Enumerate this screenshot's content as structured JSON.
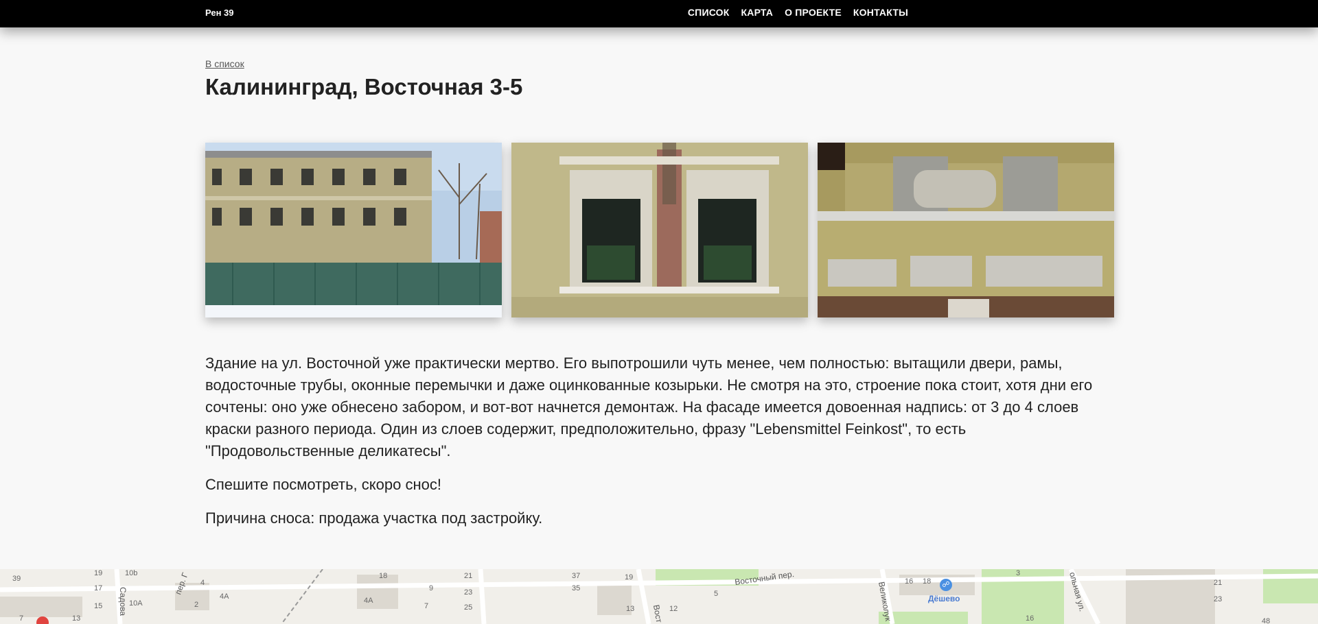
{
  "navbar": {
    "brand": "Рен 39",
    "links": [
      "СПИСОК",
      "КАРТА",
      "О ПРОЕКТЕ",
      "КОНТАКТЫ"
    ]
  },
  "back_link": "В список",
  "title": "Калининград, Восточная 3-5",
  "description": [
    "Здание на ул. Восточной уже практически мертво. Его выпотрошили чуть менее, чем полностью: вытащили двери, рамы, водосточные трубы, оконные перемычки и даже оцинкованные козырьки. Не смотря на это, строение пока стоит, хотя дни его сочтены: оно уже обнесено забором, и вот-вот начнется демонтаж. На фасаде имеется довоенная надпись: от 3 до 4 слоев краски разного периода. Один из слоев содержит, предположительно, фразу \"Lebensmittel Feinkost\", то есть \"Продовольственные деликатесы\".",
    "Спешите посмотреть, скоро снос!",
    "Причина сноса: продажа участка под застройку."
  ],
  "map": {
    "street_labels": [
      "Восточный пер.",
      "пер. Г",
      "Садова",
      "Великолук",
      "Вост",
      "ольная ул."
    ],
    "poi": "Дёшево",
    "house_numbers": [
      "39",
      "19",
      "10b",
      "17",
      "10А",
      "15",
      "13",
      "7",
      "4",
      "4А",
      "2",
      "18",
      "9",
      "4А",
      "7",
      "21",
      "23",
      "25",
      "37",
      "35",
      "19",
      "13",
      "12",
      "5",
      "16",
      "18",
      "16",
      "3",
      "21",
      "23",
      "48"
    ]
  }
}
